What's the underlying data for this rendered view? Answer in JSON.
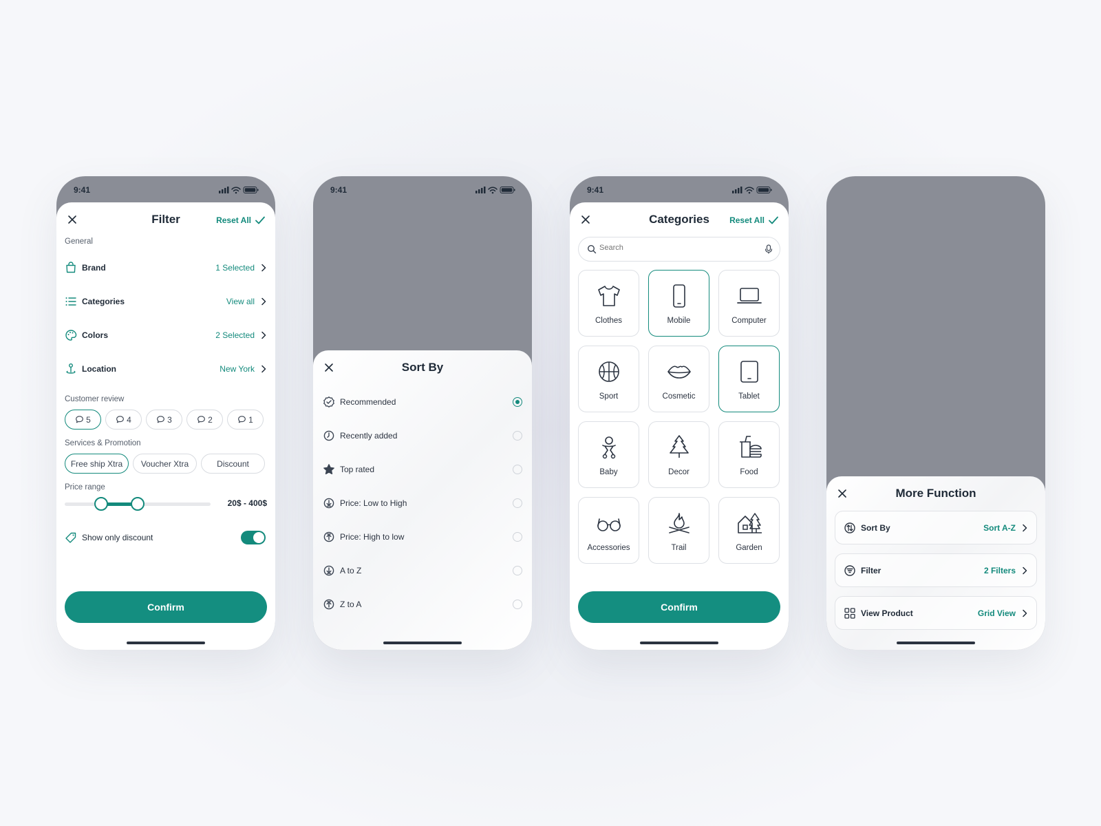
{
  "status": {
    "time": "9:41"
  },
  "filter": {
    "title": "Filter",
    "reset_label": "Reset All",
    "general_label": "General",
    "rows": [
      {
        "label": "Brand",
        "value": "1 Selected"
      },
      {
        "label": "Categories",
        "value": "View all"
      },
      {
        "label": "Colors",
        "value": "2 Selected"
      },
      {
        "label": "Location",
        "value": "New York"
      }
    ],
    "review_label": "Customer review",
    "reviews": [
      "5",
      "4",
      "3",
      "2",
      "1"
    ],
    "services_label": "Services & Promotion",
    "services": [
      "Free ship Xtra",
      "Voucher Xtra",
      "Discount"
    ],
    "price_label": "Price range",
    "price_value": "20$ - 400$",
    "discount_label": "Show only discount",
    "discount_on": true,
    "confirm_label": "Confirm"
  },
  "sort": {
    "title": "Sort By",
    "options": [
      "Recommended",
      "Recently added",
      "Top rated",
      "Price: Low to High",
      "Price: High to low",
      "A to Z",
      "Z to A"
    ],
    "selected": "Recommended"
  },
  "categories": {
    "title": "Categories",
    "reset_label": "Reset All",
    "search_placeholder": "Search",
    "items": [
      "Clothes",
      "Mobile",
      "Computer",
      "Sport",
      "Cosmetic",
      "Tablet",
      "Baby",
      "Decor",
      "Food",
      "Accessories",
      "Trail",
      "Garden"
    ],
    "selected": [
      "Mobile",
      "Tablet"
    ],
    "confirm_label": "Confirm"
  },
  "more": {
    "title": "More Function",
    "rows": [
      {
        "label": "Sort By",
        "value": "Sort A-Z"
      },
      {
        "label": "Filter",
        "value": "2 Filters"
      },
      {
        "label": "View Product",
        "value": "Grid View"
      }
    ]
  },
  "colors": {
    "accent": "#148e80",
    "backdrop": "#8a8d96"
  }
}
